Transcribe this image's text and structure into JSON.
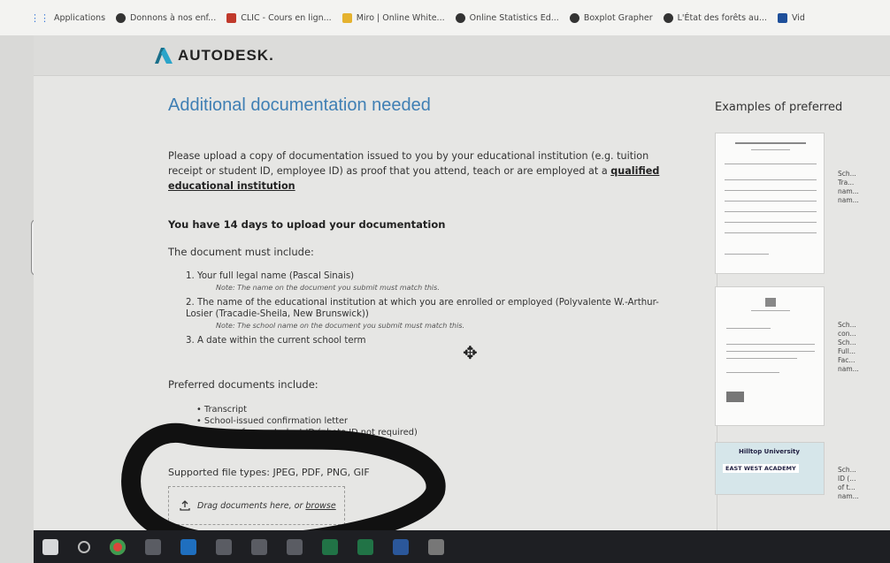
{
  "bookmarks": [
    {
      "label": "Applications",
      "icon": "apps-grid-icon"
    },
    {
      "label": "Donnons à nos enf...",
      "icon": "globe-icon"
    },
    {
      "label": "CLIC - Cours en lign...",
      "icon": "clic-icon"
    },
    {
      "label": "Miro | Online White...",
      "icon": "miro-icon"
    },
    {
      "label": "Online Statistics Ed...",
      "icon": "globe-icon"
    },
    {
      "label": "Boxplot Grapher",
      "icon": "globe-icon"
    },
    {
      "label": "L'État des forêts au...",
      "icon": "globe-icon"
    },
    {
      "label": "Vid",
      "icon": "video-icon"
    }
  ],
  "header": {
    "brand": "AUTODESK."
  },
  "main": {
    "title": "Additional documentation needed",
    "intro_text": "Please upload a copy of documentation issued to you by your educational institution (e.g. tuition receipt or student ID, employee ID) as proof that you attend, teach or are employed at a ",
    "intro_link": "qualified educational institution",
    "deadline": "You have 14 days to upload your documentation",
    "must_include": "The document must include:",
    "requirements": [
      {
        "text": "1. Your full legal name (Pascal Sinais)",
        "note": "Note: The name on the document you submit must match this."
      },
      {
        "text": "2. The name of the educational institution at which you are enrolled or employed (Polyvalente W.-Arthur-Losier (Tracadie-Sheila, New Brunswick))",
        "note": "Note: The school name on the document you submit must match this."
      },
      {
        "text": "3. A date within the current school term",
        "note": ""
      }
    ],
    "preferred": "Preferred documents include:",
    "preferred_docs": [
      "Transcript",
      "School-issued confirmation letter",
      "A copy of your student ID (photo ID not required)"
    ],
    "file_types": "Supported file types: JPEG, PDF, PNG, GIF",
    "drop_text": "Drag documents here, or ",
    "drop_link": "browse"
  },
  "side": {
    "title": "Examples of preferred",
    "captions": [
      "Sch... Tra... nam... nam...",
      "Sch... con... Sch... Full... Fac... nam...",
      "Sch... ID (... of t... nam..."
    ],
    "thumb3_text1": "Hilltop University",
    "thumb3_text2": "EAST WEST ACADEMY"
  },
  "taskbar": {
    "icons": [
      "windows-icon",
      "search-icon",
      "chrome-icon",
      "file-explorer-icon",
      "edge-icon",
      "app-icon",
      "app-icon",
      "app-icon",
      "excel-icon",
      "excel-icon",
      "word-icon",
      "calculator-icon"
    ]
  }
}
